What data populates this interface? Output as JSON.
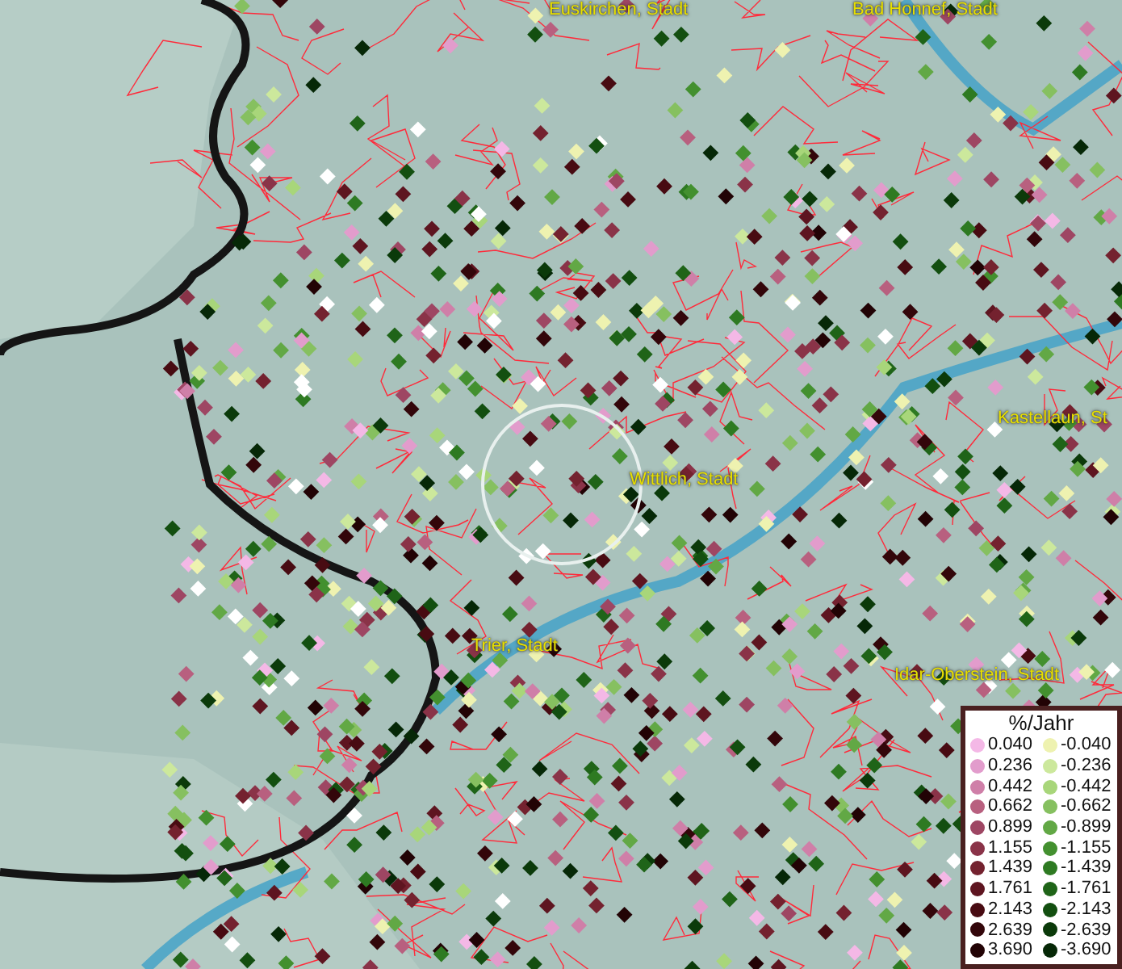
{
  "map": {
    "place_labels": [
      {
        "text": "Euskirchen, Stadt"
      },
      {
        "text": "Bad Honnef, Stadt"
      },
      {
        "text": "Kastellaun, St"
      },
      {
        "text": "Wittlich, Stadt"
      },
      {
        "text": "Trier, Stadt"
      },
      {
        "text": "Idar-Oberstein, Stadt"
      }
    ]
  },
  "legend": {
    "title": "%/Jahr",
    "columns": [
      {
        "items": [
          {
            "value": "0.040",
            "color": "#f4b8e6"
          },
          {
            "value": "0.236",
            "color": "#e29ccc"
          },
          {
            "value": "0.442",
            "color": "#cf7fa8"
          },
          {
            "value": "0.662",
            "color": "#b8607f"
          },
          {
            "value": "0.899",
            "color": "#9e4663"
          },
          {
            "value": "1.155",
            "color": "#8a3348"
          },
          {
            "value": "1.439",
            "color": "#74222f"
          },
          {
            "value": "1.761",
            "color": "#5e1520"
          },
          {
            "value": "2.143",
            "color": "#480b12"
          },
          {
            "value": "2.639",
            "color": "#33060a"
          },
          {
            "value": "3.690",
            "color": "#220305"
          }
        ]
      },
      {
        "items": [
          {
            "value": "-0.040",
            "color": "#eef2b0"
          },
          {
            "value": "-0.236",
            "color": "#cce89c"
          },
          {
            "value": "-0.442",
            "color": "#a8d67a"
          },
          {
            "value": "-0.662",
            "color": "#86c060"
          },
          {
            "value": "-0.899",
            "color": "#62a845"
          },
          {
            "value": "-1.155",
            "color": "#43902f"
          },
          {
            "value": "-1.439",
            "color": "#2e7a22"
          },
          {
            "value": "-1.761",
            "color": "#1f6418"
          },
          {
            "value": "-2.143",
            "color": "#134f10"
          },
          {
            "value": "-2.639",
            "color": "#0b3a0a"
          },
          {
            "value": "-3.690",
            "color": "#062807"
          }
        ]
      }
    ]
  }
}
